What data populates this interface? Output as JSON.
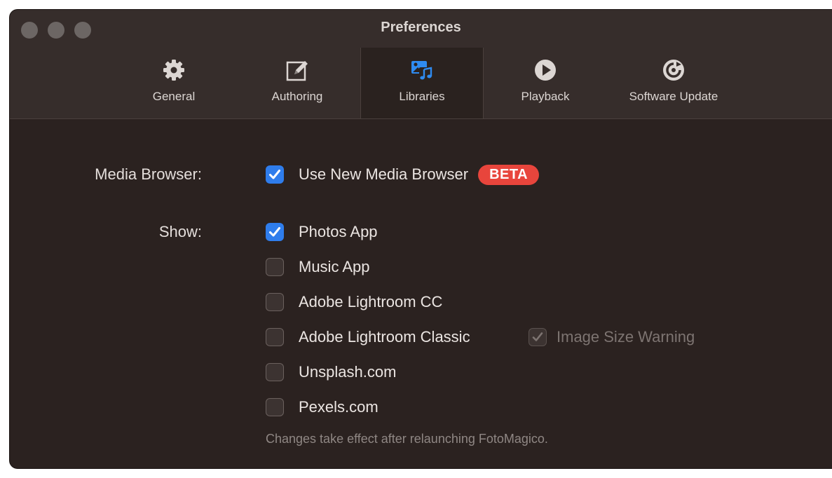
{
  "window": {
    "title": "Preferences"
  },
  "tabs": [
    {
      "label": "General",
      "icon": "gear-icon",
      "selected": false
    },
    {
      "label": "Authoring",
      "icon": "edit-icon",
      "selected": false
    },
    {
      "label": "Libraries",
      "icon": "libraries-icon",
      "selected": true
    },
    {
      "label": "Playback",
      "icon": "play-icon",
      "selected": false
    },
    {
      "label": "Software Update",
      "icon": "update-icon",
      "selected": false
    }
  ],
  "media_browser": {
    "label": "Media Browser:",
    "option_label": "Use New Media Browser",
    "checked": true,
    "badge": "BETA"
  },
  "show": {
    "label": "Show:",
    "options": [
      {
        "label": "Photos App",
        "checked": true
      },
      {
        "label": "Music App",
        "checked": false
      },
      {
        "label": "Adobe Lightroom CC",
        "checked": false
      },
      {
        "label": "Adobe Lightroom Classic",
        "checked": false
      },
      {
        "label": "Unsplash.com",
        "checked": false
      },
      {
        "label": "Pexels.com",
        "checked": false
      }
    ]
  },
  "image_size_warning": {
    "label": "Image Size Warning",
    "checked": true,
    "enabled": false
  },
  "note": "Changes take effect after relaunching FotoMagico.",
  "colors": {
    "background": "#2b2220",
    "toolbar": "#362d2b",
    "accent": "#2f7dec",
    "badge": "#e8453c",
    "libraries_icon": "#2f8bf0"
  }
}
